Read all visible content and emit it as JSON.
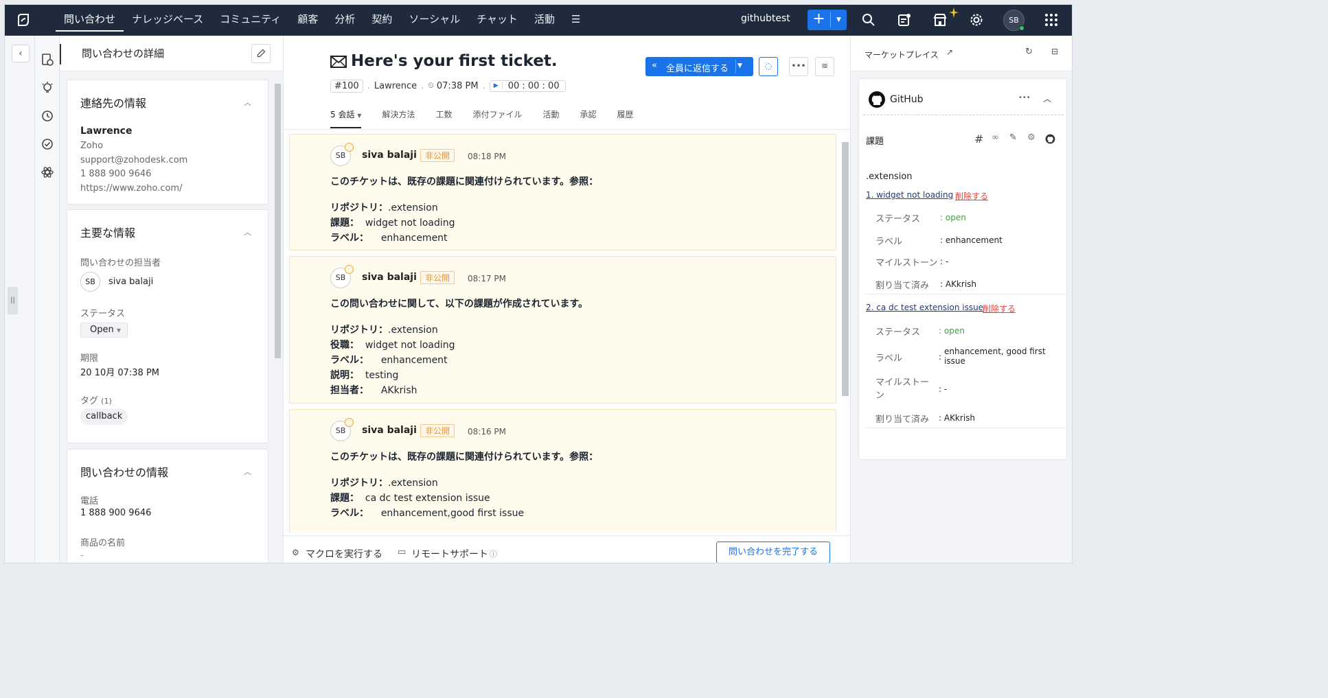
{
  "topbar": {
    "nav": [
      {
        "label": "問い合わせ",
        "active": true
      },
      {
        "label": "ナレッジベース"
      },
      {
        "label": "コミュニティ"
      },
      {
        "label": "顧客"
      },
      {
        "label": "分析"
      },
      {
        "label": "契約"
      },
      {
        "label": "ソーシャル"
      },
      {
        "label": "チャット"
      },
      {
        "label": "活動"
      },
      {
        "label": "☰"
      }
    ],
    "department": "githubtest",
    "add_label": "+",
    "user_initials": "SB"
  },
  "left_panel": {
    "title": "問い合わせの詳細",
    "contact": {
      "heading": "連絡先の情報",
      "name": "Lawrence",
      "company": "Zoho",
      "email": "support@zohodesk.com",
      "phone": "1 888 900 9646",
      "website": "https://www.zoho.com/"
    },
    "key_info": {
      "heading": "主要な情報",
      "owner_label": "問い合わせの担当者",
      "owner_initials": "SB",
      "owner_name": "siva balaji",
      "status_label": "ステータス",
      "status_value": "Open",
      "due_label": "期限",
      "due_value": "20 10月 07:38 PM",
      "tags_label": "タグ",
      "tags_count": "(1)",
      "tag": "callback"
    },
    "ticket_info": {
      "heading": "問い合わせの情報",
      "phone_label": "電話",
      "phone_value": "1 888 900 9646",
      "product_label": "商品の名前",
      "product_value": "-"
    }
  },
  "ticket": {
    "subject": "Here's your first ticket.",
    "number": "#100",
    "contact": "Lawrence",
    "time": "07:38 PM",
    "timer": "00 : 00 : 00",
    "reply_all_label": "全員に返信する",
    "tabs": [
      {
        "label": "5 会話",
        "active": true
      },
      {
        "label": "解決方法"
      },
      {
        "label": "工数"
      },
      {
        "label": "添付ファイル"
      },
      {
        "label": "活動"
      },
      {
        "label": "承認"
      },
      {
        "label": "履歴"
      }
    ],
    "messages": [
      {
        "initials": "SB",
        "author": "siva balaji",
        "visibility": "非公開",
        "time": "08:18 PM",
        "heading": "このチケットは、既存の課題に関連付けられています。参照：",
        "lines": [
          {
            "k": "リポジトリ：",
            "v": ".extension"
          },
          {
            "k": "課題：",
            "v": "widget not loading"
          },
          {
            "k": "ラベル：",
            "v": "enhancement"
          }
        ]
      },
      {
        "initials": "SB",
        "author": "siva balaji",
        "visibility": "非公開",
        "time": "08:17 PM",
        "heading": "この問い合わせに関して、以下の課題が作成されています。",
        "lines": [
          {
            "k": "リポジトリ：",
            "v": ".extension"
          },
          {
            "k": "役職：",
            "v": "widget not loading"
          },
          {
            "k": "ラベル：",
            "v": "enhancement"
          },
          {
            "k": "説明：",
            "v": "testing"
          },
          {
            "k": "担当者：",
            "v": "AKkrish"
          }
        ]
      },
      {
        "initials": "SB",
        "author": "siva balaji",
        "visibility": "非公開",
        "time": "08:16 PM",
        "heading": "このチケットは、既存の課題に関連付けられています。参照：",
        "lines": [
          {
            "k": "リポジトリ：",
            "v": ".extension"
          },
          {
            "k": "課題：",
            "v": "ca dc test extension issue"
          },
          {
            "k": "ラベル：",
            "v": "enhancement,good first issue"
          }
        ]
      }
    ],
    "footer": {
      "macro": "マクロを実行する",
      "remote": "リモートサポート",
      "finish": "問い合わせを完了する"
    }
  },
  "right_panel": {
    "title": "マーケットプレイス",
    "app_name": "GitHub",
    "issues_label": "課題",
    "repo": ".extension",
    "delete_label": "削除する",
    "issues": [
      {
        "title": "1. widget not loading",
        "status_k": "ステータス",
        "status": ": open",
        "label_k": "ラベル",
        "label": ": enhancement",
        "milestone_k": "マイルストーン",
        "milestone": ": -",
        "assignee_k": "割り当て済み",
        "assignee": ": AKkrish"
      },
      {
        "title": "2. ca dc test extension issue",
        "status_k": "ステータス",
        "status": ": open",
        "label_k": "ラベル",
        "label": "enhancement, good first issue",
        "milestone_k": "マイルストーン",
        "milestone": ": -",
        "assignee_k": "割り当て済み",
        "assignee": ": AKkrish"
      }
    ]
  },
  "colors": {
    "topbar": "#1f2a3c",
    "accent": "#1a73e8",
    "private": "#e3963a",
    "open": "#43a047",
    "delete": "#e0443c"
  }
}
